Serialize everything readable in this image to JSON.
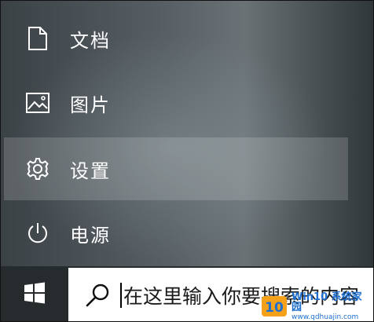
{
  "start_menu": {
    "items": [
      {
        "label": "文档",
        "icon": "document-icon"
      },
      {
        "label": "图片",
        "icon": "pictures-icon"
      },
      {
        "label": "设置",
        "icon": "gear-icon",
        "active": true
      },
      {
        "label": "电源",
        "icon": "power-icon"
      }
    ]
  },
  "taskbar": {
    "start_button_icon": "windows-logo-icon",
    "search": {
      "icon": "search-icon",
      "placeholder": "在这里输入你要搜索的内容"
    }
  },
  "watermark": {
    "logo_text": "10",
    "title": "Win10 系统家园",
    "url": "www.qdhuajin.com"
  },
  "colors": {
    "menu_text": "#ffffff",
    "taskbar_bg": "#262b2e",
    "search_bg": "#ffffff",
    "active_highlight": "rgba(255,255,255,0.16)",
    "watermark_blue": "#1e6fd0"
  }
}
